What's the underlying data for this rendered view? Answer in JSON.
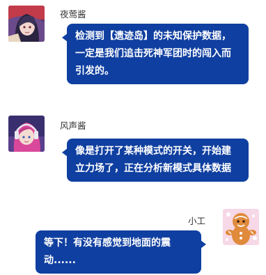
{
  "messages": [
    {
      "sender": "夜莺酱",
      "avatar_icon": "dark-haired-character-avatar-icon",
      "text": "检测到【遗迹岛】的未知保护数据，一定是我们追击死神军团时的闯入而引发的。"
    },
    {
      "sender": "风声酱",
      "avatar_icon": "pink-haired-headset-character-avatar-icon",
      "text": "像是打开了某种模式的开关，开始建立力场了，正在分析新模式具体数据"
    },
    {
      "sender": "小工",
      "avatar_icon": "gingerbread-man-avatar-icon",
      "text": "等下！有没有感觉到地面的震动......"
    }
  ],
  "colors": {
    "bubble": "#0f3fa0",
    "bubble_text": "#ffffff",
    "name_text": "#333333",
    "background": "#ffffff"
  }
}
